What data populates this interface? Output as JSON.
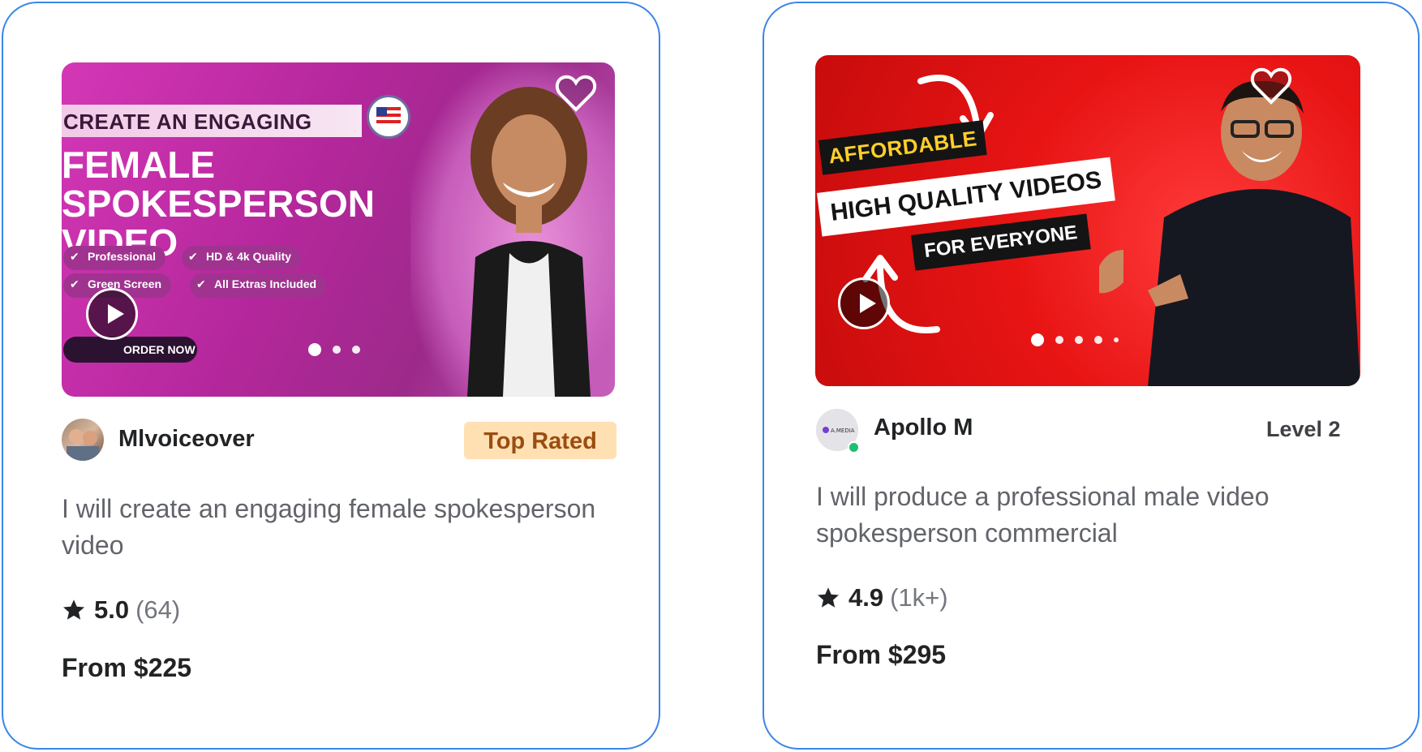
{
  "cards": [
    {
      "thumbnail": {
        "headline": "CREATE AN ENGAGING",
        "big_text": "FEMALE SPOKESPERSON VIDEO",
        "features": [
          "Professional",
          "HD & 4k Quality",
          "Green Screen",
          "All Extras Included"
        ],
        "cta": "ORDER NOW",
        "carousel_dots": 3,
        "active_dot": 0
      },
      "seller": {
        "name": "Mlvoiceover",
        "badge": "Top Rated"
      },
      "title": "I will create an engaging female spokesperson video",
      "rating": {
        "value": "5.0",
        "count": "(64)"
      },
      "price": "From $225"
    },
    {
      "thumbnail": {
        "tag": "AFFORDABLE",
        "headline": "HIGH QUALITY VIDEOS",
        "sub": "FOR EVERYONE",
        "carousel_dots": 5,
        "active_dot": 0
      },
      "seller": {
        "name": "Apollo M",
        "level": "Level 2",
        "online": true,
        "avatar_text": "A.MEDIA"
      },
      "title": "I will produce a professional male video spokesperson commercial",
      "rating": {
        "value": "4.9",
        "count": "(1k+)"
      },
      "price": "From $295"
    }
  ],
  "icons": {
    "favorite": "heart-icon",
    "play": "play-icon",
    "rating": "star-icon"
  },
  "colors": {
    "card_border": "#3a86e8",
    "top_rated_bg": "#ffe0b3",
    "top_rated_text": "#9b4d11",
    "online": "#1dbf73"
  }
}
